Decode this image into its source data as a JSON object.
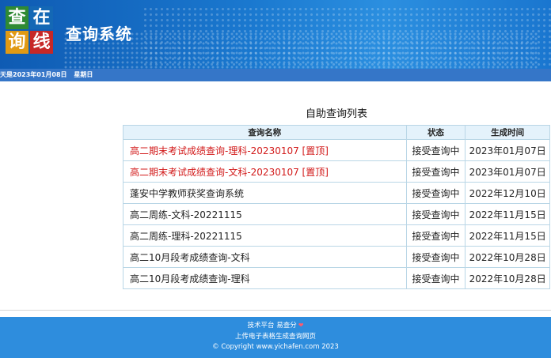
{
  "header": {
    "logo": {
      "chars": [
        "查",
        "在",
        "询",
        "线"
      ],
      "colors": [
        "#2f8a34",
        "#1468b5",
        "#e09a14",
        "#c62828"
      ]
    },
    "title": "查询系统"
  },
  "date_bar": {
    "date_text": "天是2023年01月08日",
    "weekday": "星期日"
  },
  "list": {
    "title": "自助查询列表",
    "columns": [
      "查询名称",
      "状态",
      "生成时间"
    ],
    "rows": [
      {
        "name": "高二期末考试成绩查询-理科-20230107 [置顶]",
        "status": "接受查询中",
        "time": "2023年01月07日",
        "pinned": true
      },
      {
        "name": "高二期末考试成绩查询-文科-20230107 [置顶]",
        "status": "接受查询中",
        "time": "2023年01月07日",
        "pinned": true
      },
      {
        "name": "蓬安中学教师获奖查询系统",
        "status": "接受查询中",
        "time": "2022年12月10日",
        "pinned": false
      },
      {
        "name": "高二周练-文科-20221115",
        "status": "接受查询中",
        "time": "2022年11月15日",
        "pinned": false
      },
      {
        "name": "高二周练-理科-20221115",
        "status": "接受查询中",
        "time": "2022年11月15日",
        "pinned": false
      },
      {
        "name": "高二10月段考成绩查询-文科",
        "status": "接受查询中",
        "time": "2022年10月28日",
        "pinned": false
      },
      {
        "name": "高二10月段考成绩查询-理科",
        "status": "接受查询中",
        "time": "2022年10月28日",
        "pinned": false
      }
    ]
  },
  "footer": {
    "support_text": "技术平台 易查分",
    "upload_text": "上传电子表格生成查询网页",
    "copyright": "© Copyright www.yichafen.com 2023",
    "accent": "#ff5a6e"
  }
}
